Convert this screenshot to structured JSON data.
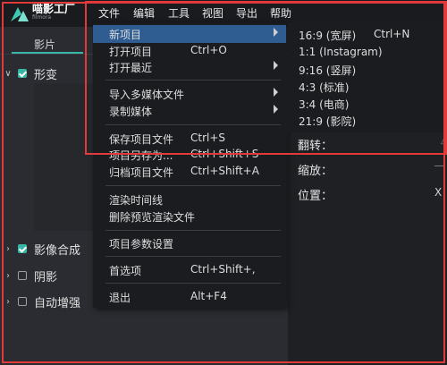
{
  "app": {
    "name": "喵影工厂",
    "subtitle": "filmora"
  },
  "menubar": [
    "文件",
    "编辑",
    "工具",
    "视图",
    "导出",
    "帮助"
  ],
  "left_panel": {
    "tab": "影片",
    "rows": [
      {
        "label": "形变",
        "checked": true
      },
      {
        "label": "影像合成",
        "checked": true
      },
      {
        "label": "阴影",
        "checked": false
      },
      {
        "label": "自动增强",
        "checked": false
      }
    ]
  },
  "right_panel": {
    "labels": [
      "翻转：",
      "缩放：",
      "位置："
    ],
    "x_label": "X"
  },
  "file_menu": {
    "items": [
      {
        "label": "新项目",
        "shortcut": "",
        "submenu": true,
        "highlighted": true
      },
      {
        "label": "打开项目",
        "shortcut": "Ctrl+O"
      },
      {
        "label": "打开最近",
        "shortcut": "",
        "submenu": true
      },
      {
        "label": "导入多媒体文件",
        "shortcut": "",
        "submenu": true
      },
      {
        "label": "录制媒体",
        "shortcut": "",
        "submenu": true
      },
      {
        "label": "保存项目文件",
        "shortcut": "Ctrl+S"
      },
      {
        "label": "项目另存为...",
        "shortcut": "Ctrl+Shift+S"
      },
      {
        "label": "归档项目文件",
        "shortcut": "Ctrl+Shift+A"
      },
      {
        "label": "渲染时间线",
        "shortcut": ""
      },
      {
        "label": "删除预览渲染文件",
        "shortcut": ""
      },
      {
        "label": "项目参数设置",
        "shortcut": ""
      },
      {
        "label": "首选项",
        "shortcut": "Ctrl+Shift+,"
      },
      {
        "label": "退出",
        "shortcut": "Alt+F4"
      }
    ]
  },
  "new_project_submenu": {
    "items": [
      {
        "label": "16:9 (宽屏)",
        "shortcut": "Ctrl+N"
      },
      {
        "label": "1:1 (Instagram)",
        "shortcut": ""
      },
      {
        "label": "9:16 (竖屏)",
        "shortcut": ""
      },
      {
        "label": "4:3 (标准)",
        "shortcut": ""
      },
      {
        "label": "3:4 (电商)",
        "shortcut": ""
      },
      {
        "label": "21:9 (影院)",
        "shortcut": ""
      }
    ]
  },
  "colors": {
    "highlight": "#2f5d92",
    "accent": "#37b5a5",
    "annotation": "#e23a3a"
  }
}
